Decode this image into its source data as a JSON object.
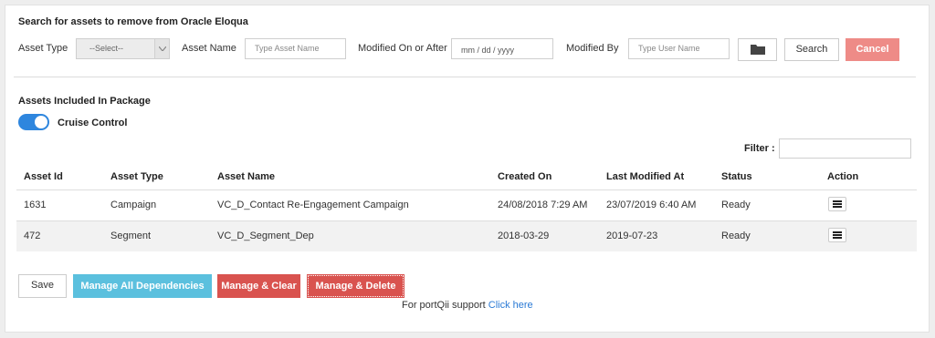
{
  "search": {
    "heading": "Search for assets to remove from Oracle Eloqua",
    "asset_type_label": "Asset Type",
    "asset_type_value": "--Select--",
    "asset_name_label": "Asset Name",
    "asset_name_placeholder": "Type Asset Name",
    "modified_label": "Modified On or After",
    "modified_placeholder": "mm / dd / yyyy",
    "modified_by_label": "Modified By",
    "modified_by_placeholder": "Type User Name",
    "folder_icon": "folder-icon",
    "search_button": "Search",
    "cancel_button": "Cancel"
  },
  "package": {
    "heading": "Assets Included In Package",
    "cruise_control_label": "Cruise Control",
    "cruise_control_on": true,
    "filter_label": "Filter :"
  },
  "table": {
    "columns": [
      "Asset Id",
      "Asset Type",
      "Asset Name",
      "Created On",
      "Last Modified At",
      "Status",
      "Action"
    ],
    "rows": [
      {
        "id": "1631",
        "type": "Campaign",
        "name": "VC_D_Contact Re-Engagement Campaign",
        "created": "24/08/2018 7:29 AM",
        "modified": "23/07/2019 6:40 AM",
        "status": "Ready",
        "action_icon": "hamburger-menu-icon"
      },
      {
        "id": "472",
        "type": "Segment",
        "name": "VC_D_Segment_Dep",
        "created": "2018-03-29",
        "modified": "2019-07-23",
        "status": "Ready",
        "action_icon": "hamburger-menu-icon"
      }
    ]
  },
  "footer": {
    "save_button": "Save",
    "manage_all_button": "Manage All Dependencies",
    "manage_clear_button": "Manage & Clear",
    "manage_delete_button": "Manage & Delete",
    "support_text": "For portQii support",
    "support_link": "Click here"
  },
  "colors": {
    "accent_blue": "#5bc0de",
    "danger_red": "#d9534f",
    "cancel_red": "#ee8b87",
    "toggle_blue": "#2e86de",
    "link_blue": "#2a7ad5"
  }
}
